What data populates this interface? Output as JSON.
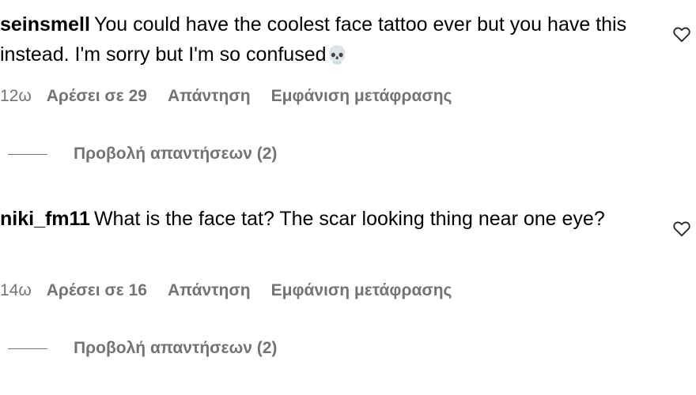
{
  "comments": [
    {
      "username": "seinsmell",
      "text": "You could have the coolest face tattoo ever but you have this instead. I'm sorry but I'm so confused",
      "emoji": "💀",
      "time": "12ω",
      "likes": "Αρέσει σε 29",
      "reply_label": "Απάντηση",
      "translate_label": "Εμφάνιση μετάφρασης",
      "view_replies_label": "Προβολή απαντήσεων (2)",
      "like_icon": "heart-outline-icon"
    },
    {
      "username": "niki_fm11",
      "text": "What is the face tat? The scar looking thing near one eye?",
      "time": "14ω",
      "likes": "Αρέσει σε 16",
      "reply_label": "Απάντηση",
      "translate_label": "Εμφάνιση μετάφρασης",
      "view_replies_label": "Προβολή απαντήσεων (2)",
      "like_icon": "heart-outline-icon"
    }
  ],
  "colors": {
    "text": "#000000",
    "secondary": "#737373",
    "background": "#ffffff"
  }
}
